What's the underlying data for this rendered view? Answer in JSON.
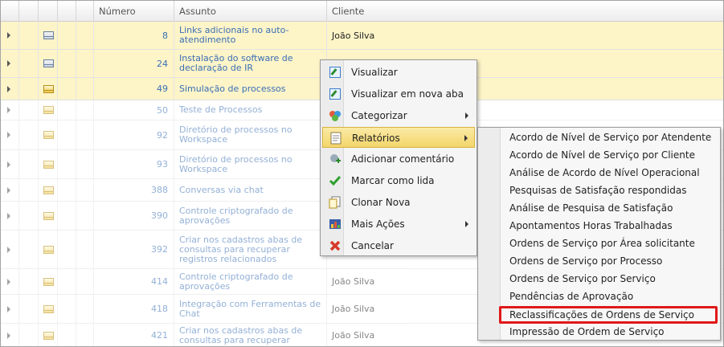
{
  "grid": {
    "headers": {
      "numero": "Número",
      "assunto": "Assunto",
      "cliente": "Cliente"
    },
    "rows": [
      {
        "numero": "8",
        "assunto": "Links adicionais no auto-atendimento",
        "cliente": "João Silva",
        "highlight": true,
        "mail": "open"
      },
      {
        "numero": "24",
        "assunto": "Instalação do software de declaração de IR",
        "cliente": "",
        "highlight": true,
        "mail": "open"
      },
      {
        "numero": "49",
        "assunto": "Simulação de processos",
        "cliente": "",
        "highlight": true,
        "mail": "closed"
      },
      {
        "numero": "50",
        "assunto": "Teste de Processos",
        "cliente": "",
        "highlight": false,
        "mail": "closed"
      },
      {
        "numero": "92",
        "assunto": "Diretório de processos no Workspace",
        "cliente": "",
        "highlight": false,
        "mail": "closed"
      },
      {
        "numero": "93",
        "assunto": "Diretório de processos no Workspace",
        "cliente": "",
        "highlight": false,
        "mail": "closed"
      },
      {
        "numero": "388",
        "assunto": "Conversas via chat",
        "cliente": "",
        "highlight": false,
        "mail": "closed"
      },
      {
        "numero": "390",
        "assunto": "Controle criptografado de aprovações",
        "cliente": "",
        "highlight": false,
        "mail": "closed"
      },
      {
        "numero": "392",
        "assunto": "Criar nos cadastros abas de consultas para recuperar registros relacionados",
        "cliente": "",
        "highlight": false,
        "mail": "closed"
      },
      {
        "numero": "414",
        "assunto": "Controle criptografado de aprovações",
        "cliente": "João Silva",
        "highlight": false,
        "mail": "closed"
      },
      {
        "numero": "418",
        "assunto": "Integração com Ferramentas de Chat",
        "cliente": "João Silva",
        "highlight": false,
        "mail": "closed"
      },
      {
        "numero": "421",
        "assunto": "Criar nos cadastros abas de consultas para recuperar",
        "cliente": "João Silva",
        "highlight": false,
        "mail": "closed"
      }
    ]
  },
  "context_menu": {
    "items": [
      {
        "label": "Visualizar",
        "icon": "view-icon"
      },
      {
        "label": "Visualizar em nova aba",
        "icon": "view-new-tab-icon"
      },
      {
        "label": "Categorizar",
        "icon": "categorize-icon",
        "submenu": true
      },
      {
        "label": "Relatórios",
        "icon": "report-icon",
        "submenu": true,
        "active": true
      },
      {
        "label": "Adicionar comentário",
        "icon": "add-comment-icon"
      },
      {
        "label": "Marcar como lida",
        "icon": "check-icon"
      },
      {
        "label": "Clonar Nova",
        "icon": "clone-icon"
      },
      {
        "label": "Mais Ações",
        "icon": "more-actions-icon",
        "submenu": true
      },
      {
        "label": "Cancelar",
        "icon": "cancel-icon"
      }
    ]
  },
  "reports_submenu": {
    "items": [
      "Acordo de Nível de Serviço por Atendente",
      "Acordo de Nível de Serviço por Cliente",
      "Análise de Acordo de Nível Operacional",
      "Pesquisas de Satisfação respondidas",
      "Análise de Pesquisa de Satisfação",
      "Apontamentos Horas Trabalhadas",
      "Ordens de Serviço por Área solicitante",
      "Ordens de Serviço por Processo",
      "Ordens de Serviço por Serviço",
      "Pendências de Aprovação",
      "Reclassificações de Ordens de Serviço",
      "Impressão de Ordem de Serviço"
    ],
    "marked_index": 10,
    "marker_color": "#e01818"
  },
  "colors": {
    "row_highlight": "#fdf4c8",
    "link_text": "#3a6fb5",
    "menu_active": "#f3d56a"
  }
}
